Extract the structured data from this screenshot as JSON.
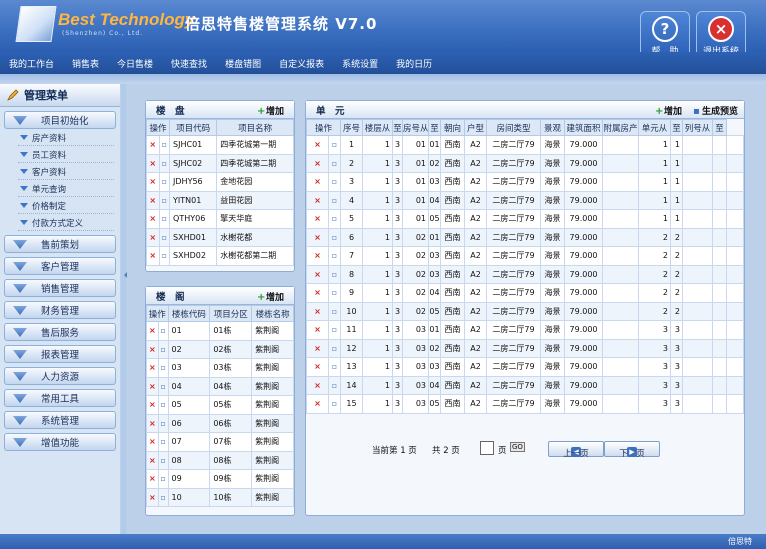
{
  "header": {
    "brand": "Best Technology",
    "brand_sub": "(Shenzhen) Co., Ltd.",
    "title": "倍思特售楼管理系统 V7.0",
    "help_label": "帮　助",
    "exit_label": "退出系统"
  },
  "nav": [
    "我的工作台",
    "销售表",
    "今日售楼",
    "快速查找",
    "楼盘错图",
    "自定义报表",
    "系统设置",
    "我的日历"
  ],
  "sidebar": {
    "title": "管理菜单",
    "sections": [
      "项目初始化",
      "售前策划",
      "客户管理",
      "销售管理",
      "财务管理",
      "售后服务",
      "报表管理",
      "人力资源",
      "常用工具",
      "系统管理",
      "增值功能"
    ],
    "sub_items": [
      "房产资料",
      "员工资料",
      "客户资料",
      "单元查询",
      "价格制定",
      "付款方式定义"
    ]
  },
  "loupan": {
    "title": "楼　盘",
    "add": "增加",
    "headers": [
      "操作",
      "项目代码",
      "项目名称"
    ],
    "rows": [
      [
        "SJHC01",
        "四季花城第一期"
      ],
      [
        "SJHC02",
        "四季花城第二期"
      ],
      [
        "JDHY56",
        "金地花园"
      ],
      [
        "YITN01",
        "益田花园"
      ],
      [
        "QTHY06",
        "擎天华庭"
      ],
      [
        "SXHD01",
        "水榭花都"
      ],
      [
        "SXHD02",
        "水榭花都第二期"
      ]
    ]
  },
  "louge": {
    "title": "楼　阁",
    "add": "增加",
    "headers": [
      "操作",
      "楼栋代码",
      "项目分区",
      "楼栋名称"
    ],
    "rows": [
      [
        "01",
        "01栋",
        "紫荆阁"
      ],
      [
        "02",
        "02栋",
        "紫荆阁"
      ],
      [
        "03",
        "03栋",
        "紫荆阁"
      ],
      [
        "04",
        "04栋",
        "紫荆阁"
      ],
      [
        "05",
        "05栋",
        "紫荆阁"
      ],
      [
        "06",
        "06栋",
        "紫荆阁"
      ],
      [
        "07",
        "07栋",
        "紫荆阁"
      ],
      [
        "08",
        "08栋",
        "紫荆阁"
      ],
      [
        "09",
        "09栋",
        "紫荆阁"
      ],
      [
        "10",
        "10栋",
        "紫荆阁"
      ]
    ]
  },
  "units": {
    "title": "单　元",
    "add": "增加",
    "preview": "生成预览",
    "headers": [
      "操作",
      "序号",
      "楼层从",
      "至",
      "房号从",
      "至",
      "朝向",
      "户型",
      "房间类型",
      "景观",
      "建筑面积",
      "附属房产",
      "单元从",
      "至",
      "列号从",
      "至"
    ],
    "rows": [
      [
        "1",
        "1",
        "3",
        "01",
        "01",
        "西南",
        "A2",
        "二房二厅79",
        "海景",
        "79.000",
        "1",
        "1"
      ],
      [
        "2",
        "1",
        "3",
        "01",
        "02",
        "西南",
        "A2",
        "二房二厅79",
        "海景",
        "79.000",
        "1",
        "1"
      ],
      [
        "3",
        "1",
        "3",
        "01",
        "03",
        "西南",
        "A2",
        "二房二厅79",
        "海景",
        "79.000",
        "1",
        "1"
      ],
      [
        "4",
        "1",
        "3",
        "01",
        "04",
        "西南",
        "A2",
        "二房二厅79",
        "海景",
        "79.000",
        "1",
        "1"
      ],
      [
        "5",
        "1",
        "3",
        "01",
        "05",
        "西南",
        "A2",
        "二房二厅79",
        "海景",
        "79.000",
        "1",
        "1"
      ],
      [
        "6",
        "1",
        "3",
        "02",
        "01",
        "西南",
        "A2",
        "二房二厅79",
        "海景",
        "79.000",
        "2",
        "2"
      ],
      [
        "7",
        "1",
        "3",
        "02",
        "03",
        "西南",
        "A2",
        "二房二厅79",
        "海景",
        "79.000",
        "2",
        "2"
      ],
      [
        "8",
        "1",
        "3",
        "02",
        "03",
        "西南",
        "A2",
        "二房二厅79",
        "海景",
        "79.000",
        "2",
        "2"
      ],
      [
        "9",
        "1",
        "3",
        "02",
        "04",
        "西南",
        "A2",
        "二房二厅79",
        "海景",
        "79.000",
        "2",
        "2"
      ],
      [
        "10",
        "1",
        "3",
        "02",
        "05",
        "西南",
        "A2",
        "二房二厅79",
        "海景",
        "79.000",
        "2",
        "2"
      ],
      [
        "11",
        "1",
        "3",
        "03",
        "01",
        "西南",
        "A2",
        "二房二厅79",
        "海景",
        "79.000",
        "3",
        "3"
      ],
      [
        "12",
        "1",
        "3",
        "03",
        "02",
        "西南",
        "A2",
        "二房二厅79",
        "海景",
        "79.000",
        "3",
        "3"
      ],
      [
        "13",
        "1",
        "3",
        "03",
        "03",
        "西南",
        "A2",
        "二房二厅79",
        "海景",
        "79.000",
        "3",
        "3"
      ],
      [
        "14",
        "1",
        "3",
        "03",
        "04",
        "西南",
        "A2",
        "二房二厅79",
        "海景",
        "79.000",
        "3",
        "3"
      ],
      [
        "15",
        "1",
        "3",
        "03",
        "05",
        "西南",
        "A2",
        "二房二厅79",
        "海景",
        "79.000",
        "3",
        "3"
      ]
    ]
  },
  "pager": {
    "current": "当前第 1 页",
    "total": "共 2 页",
    "page_suffix": "页",
    "go": "GO",
    "prev": "上一页",
    "next": "下一页"
  },
  "footer": {
    "text": "倍思特"
  }
}
